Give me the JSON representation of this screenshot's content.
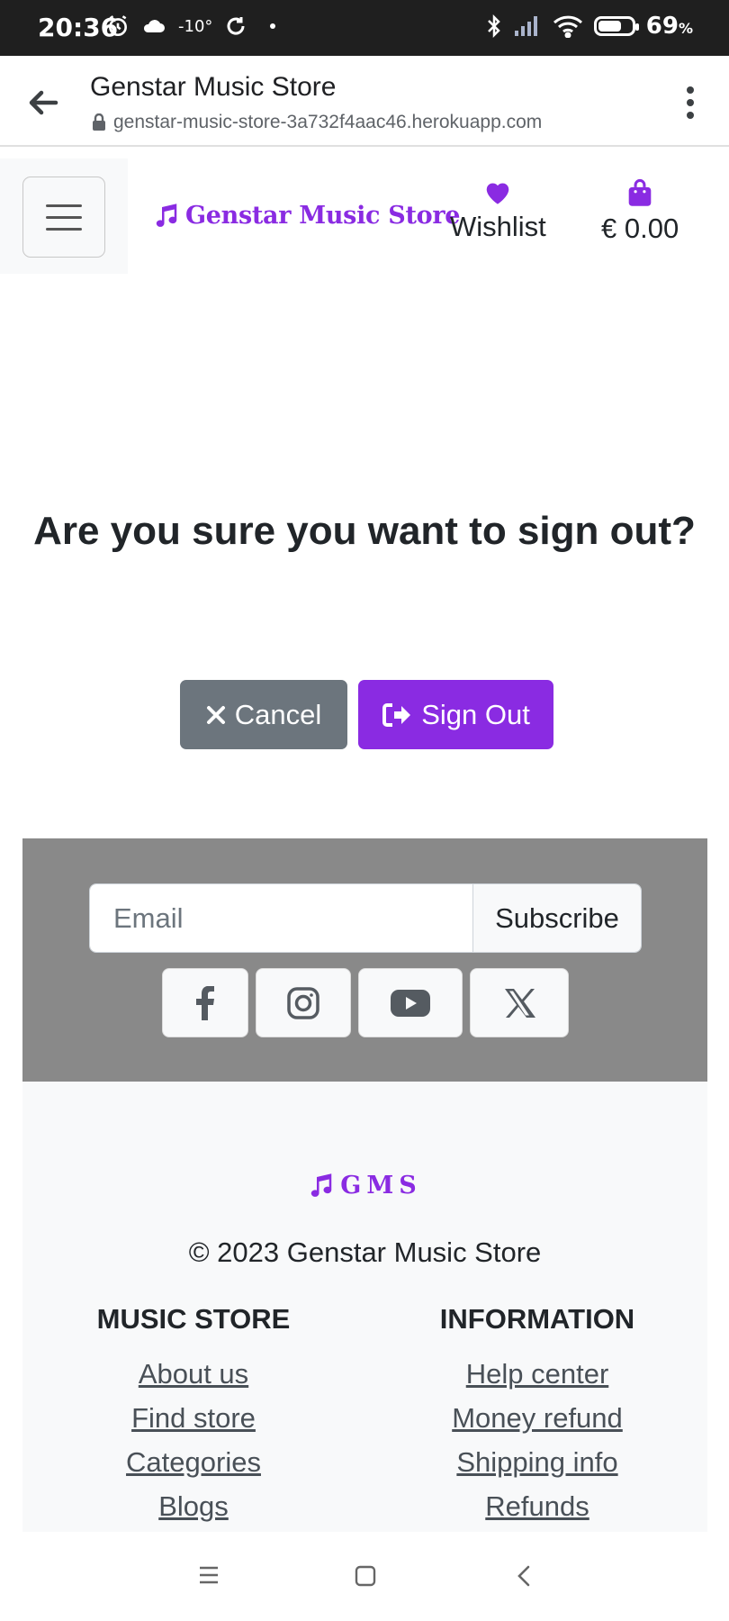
{
  "status_bar": {
    "time": "20:36",
    "temperature": "-10°",
    "battery": "69",
    "battery_unit": "%",
    "battery_level": 0.69
  },
  "browser": {
    "title": "Genstar Music Store",
    "url": "genstar-music-store-3a732f4aac46.herokuapp.com"
  },
  "header": {
    "logo_text": "Genstar Music Store",
    "wishlist_label": "Wishlist",
    "cart_total": "€ 0.00"
  },
  "main": {
    "heading": "Are you sure you want to sign out?",
    "cancel_label": "Cancel",
    "signout_label": "Sign Out"
  },
  "footer": {
    "email_placeholder": "Email",
    "subscribe_label": "Subscribe",
    "social": [
      "facebook-icon",
      "instagram-icon",
      "youtube-icon",
      "x-twitter-icon"
    ],
    "logo_short": "GMS",
    "copyright": "© 2023 Genstar Music Store",
    "columns": [
      {
        "title": "MUSIC STORE",
        "links": [
          "About us",
          "Find store",
          "Categories",
          "Blogs"
        ]
      },
      {
        "title": "INFORMATION",
        "links": [
          "Help center",
          "Money refund",
          "Shipping info",
          "Refunds"
        ]
      }
    ]
  },
  "colors": {
    "brand": "#8a2be2",
    "secondary": "#6c757d",
    "footer_top_bg": "#898989",
    "footer_bottom_bg": "#f8f9fa"
  }
}
